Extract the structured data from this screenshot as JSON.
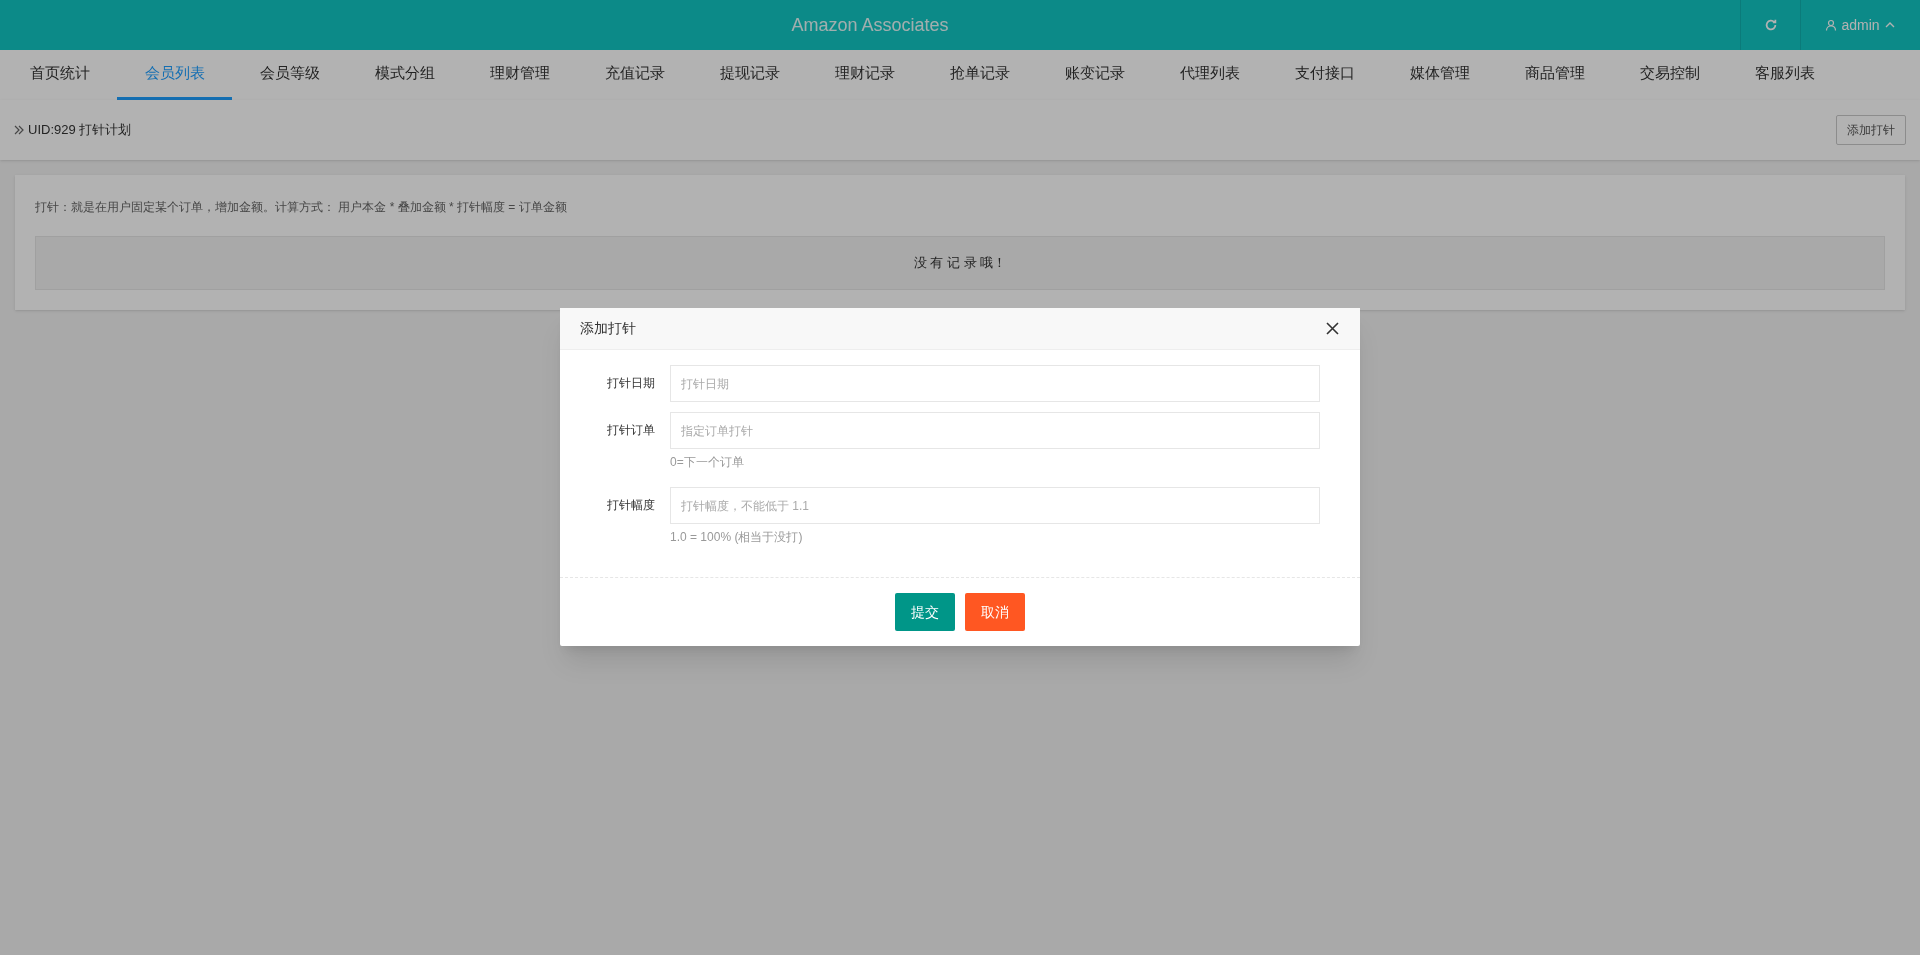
{
  "header": {
    "title": "Amazon Associates",
    "user": "admin"
  },
  "tabs": [
    {
      "label": "首页统计",
      "selected": false
    },
    {
      "label": "会员列表",
      "selected": true
    },
    {
      "label": "会员等级",
      "selected": false
    },
    {
      "label": "模式分组",
      "selected": false
    },
    {
      "label": "理财管理",
      "selected": false
    },
    {
      "label": "充值记录",
      "selected": false
    },
    {
      "label": "提现记录",
      "selected": false
    },
    {
      "label": "理财记录",
      "selected": false
    },
    {
      "label": "抢单记录",
      "selected": false
    },
    {
      "label": "账变记录",
      "selected": false
    },
    {
      "label": "代理列表",
      "selected": false
    },
    {
      "label": "支付接口",
      "selected": false
    },
    {
      "label": "媒体管理",
      "selected": false
    },
    {
      "label": "商品管理",
      "selected": false
    },
    {
      "label": "交易控制",
      "selected": false
    },
    {
      "label": "客服列表",
      "selected": false
    }
  ],
  "breadcrumb": "UID:929 打针计划",
  "add_button": "添加打针",
  "description": "打针：就是在用户固定某个订单，增加金额。计算方式： 用户本金 * 叠加金额 * 打针幅度 = 订单金额",
  "empty_message": "没 有 记 录 哦！",
  "dialog": {
    "title": "添加打针",
    "fields": [
      {
        "label": "打针日期",
        "placeholder": "打针日期"
      },
      {
        "label": "打针订单",
        "placeholder": "指定订单打针",
        "hint": "0=下一个订单"
      },
      {
        "label": "打针幅度",
        "placeholder": "打针幅度，不能低于 1.1",
        "hint": "1.0 = 100% (相当于没打)"
      }
    ],
    "submit": "提交",
    "cancel": "取消"
  }
}
